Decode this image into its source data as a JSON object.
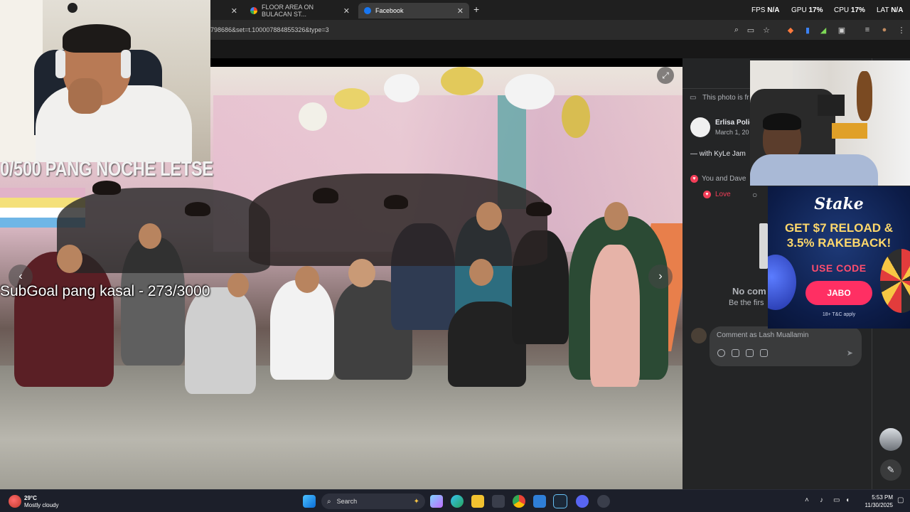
{
  "browser": {
    "tabs": [
      {
        "label": "",
        "active": false
      },
      {
        "label": "FLOOR AREA ON BULACAN ST...",
        "active": false,
        "icon": "google-icon"
      },
      {
        "label": "Facebook",
        "active": true,
        "icon": "facebook-icon"
      }
    ],
    "new_tab": "+",
    "url": "798686&set=t.100007884855326&type=3",
    "perf": {
      "fps_label": "FPS",
      "fps_value": "N/A",
      "gpu_label": "GPU",
      "gpu_value": "17%",
      "cpu_label": "CPU",
      "cpu_value": "17%",
      "lat_label": "LAT",
      "lat_value": "N/A"
    }
  },
  "stream": {
    "overlay_goal": "0/500 PANG NOCHE LETSE",
    "overlay_subgoal": "SubGoal pang kasal - 273/3000"
  },
  "viewer": {
    "expand_icon": "expand-icon",
    "prev_icon": "chevron-left-icon",
    "next_icon": "chevron-right-icon"
  },
  "post": {
    "notice": "This photo is fr",
    "author": "Erlisa Polic",
    "date": "March 1, 20",
    "with_text": "— with KyLe Jam",
    "reactions": "You and Dave",
    "love_label": "Love",
    "no_comments": "No com",
    "be_first": "Be the firs",
    "comment_placeholder": "Comment as Lash Muallamin"
  },
  "ad": {
    "brand": "Stake",
    "headline_1": "GET $7 RELOAD &",
    "headline_2": "3.5% RAKEBACK!",
    "use_code": "USE CODE",
    "code": "JABO",
    "fine_print": "18+ T&C apply"
  },
  "taskbar": {
    "temp": "29°C",
    "weather": "Mostly cloudy",
    "search_label": "Search",
    "time": "5:53 PM",
    "date": "11/30/2025"
  },
  "colors": {
    "accent_love": "#f33e58",
    "ad_button": "#ff2f63",
    "ad_headline": "#ffd86b"
  }
}
